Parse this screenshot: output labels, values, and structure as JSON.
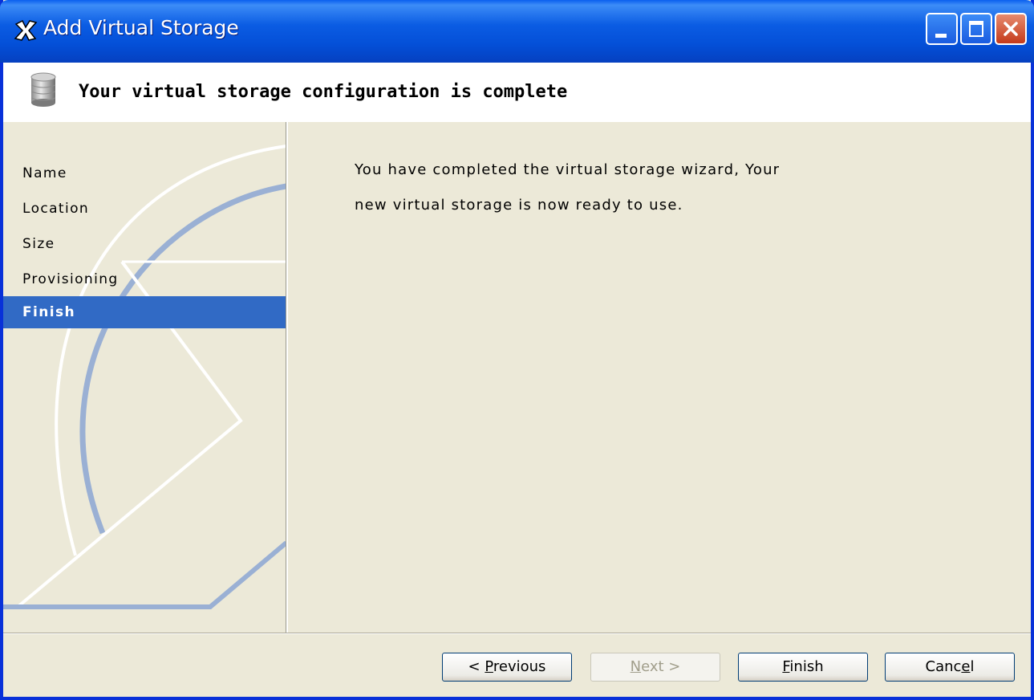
{
  "window": {
    "title": "Add Virtual Storage",
    "controls": [
      "minimize",
      "maximize",
      "close"
    ]
  },
  "header": {
    "title": "Your virtual storage configuration is complete",
    "icon": "database-icon"
  },
  "steps": [
    {
      "label": "Name",
      "active": false
    },
    {
      "label": "Location",
      "active": false
    },
    {
      "label": "Size",
      "active": false
    },
    {
      "label": "Provisioning",
      "active": false
    },
    {
      "label": "Finish",
      "active": true
    }
  ],
  "content": {
    "line1": "You have completed the virtual storage wizard, Your",
    "line2": "new virtual storage is now ready to use."
  },
  "buttons": {
    "previous": {
      "prefix": "< ",
      "mnemonic": "P",
      "rest": "revious",
      "enabled": true
    },
    "next": {
      "mnemonic": "N",
      "rest": "ext >",
      "enabled": false
    },
    "finish": {
      "mnemonic": "F",
      "rest": "inish",
      "enabled": true
    },
    "cancel": {
      "prefix": "Canc",
      "mnemonic": "e",
      "rest": "l",
      "enabled": true
    }
  },
  "colors": {
    "titlebar": "#0450D8",
    "selection": "#316AC5",
    "dialog_bg": "#ECE9D8"
  }
}
